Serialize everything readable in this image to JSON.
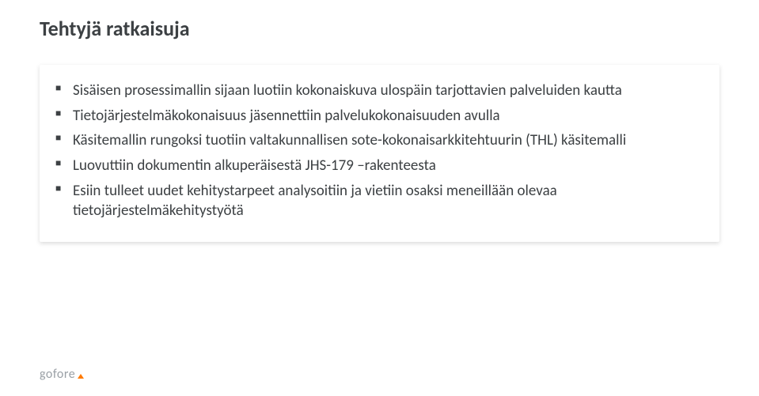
{
  "slide": {
    "title": "Tehtyjä ratkaisuja",
    "bullets": [
      "Sisäisen prosessimallin sijaan luotiin kokonaiskuva ulospäin tarjottavien palveluiden kautta",
      "Tietojärjestelmäkokonaisuus jäsennettiin palvelukokonaisuuden avulla",
      "Käsitemallin rungoksi tuotiin valtakunnallisen sote-kokonaisarkkitehtuurin (THL) käsitemalli",
      "Luovuttiin dokumentin alkuperäisestä JHS-179 –rakenteesta",
      "Esiin tulleet uudet kehitystarpeet analysoitiin ja vietiin osaksi meneillään olevaa tietojärjestelmäkehitystyötä"
    ]
  },
  "footer": {
    "logo_text": "gofore"
  }
}
